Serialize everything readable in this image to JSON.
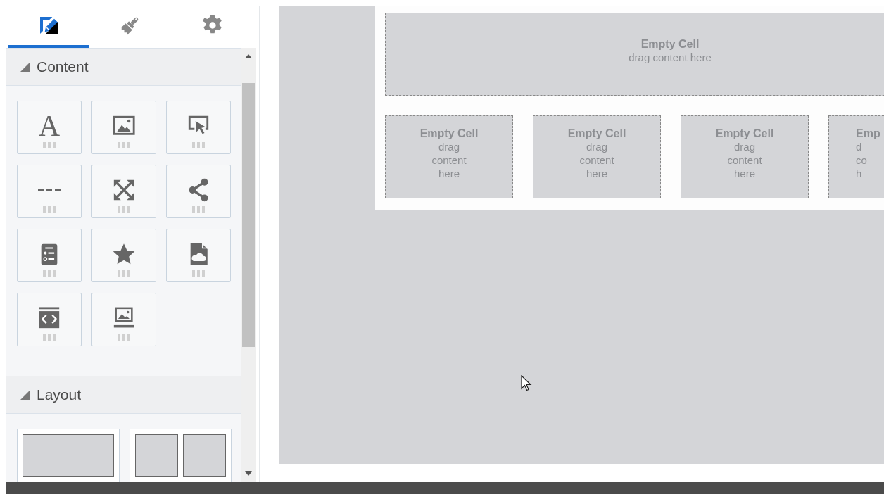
{
  "sidebar": {
    "tabs": [
      {
        "selected": true
      },
      {
        "selected": false
      },
      {
        "selected": false
      }
    ],
    "sections": [
      {
        "title": "Content",
        "expanded": true,
        "tiles": [
          {
            "kind": "glyph",
            "glyph": "A"
          },
          {
            "kind": "image"
          },
          {
            "kind": "pointer"
          },
          {
            "kind": "divider"
          },
          {
            "kind": "expand"
          },
          {
            "kind": "share"
          },
          {
            "kind": "form"
          },
          {
            "kind": "star"
          },
          {
            "kind": "document"
          },
          {
            "kind": "embed"
          },
          {
            "kind": "slideshow"
          }
        ]
      },
      {
        "title": "Layout",
        "expanded": true,
        "tiles": [
          {
            "kind": "one-column"
          },
          {
            "kind": "two-column"
          }
        ]
      }
    ]
  },
  "canvas": {
    "rows": [
      {
        "cells": [
          {
            "title": "Empty Cell",
            "hint": "drag content here"
          }
        ]
      },
      {
        "cells": [
          {
            "title": "Empty Cell",
            "hint": "drag content here"
          },
          {
            "title": "Empty Cell",
            "hint": "drag content here"
          },
          {
            "title": "Empty Cell",
            "hint": "drag content here"
          },
          {
            "title": "Emp",
            "hint": "d co h"
          }
        ]
      }
    ]
  }
}
